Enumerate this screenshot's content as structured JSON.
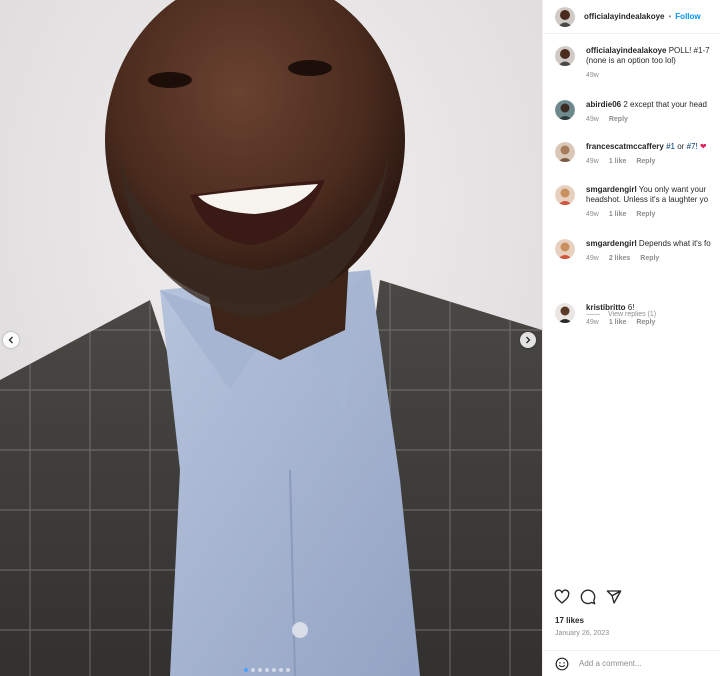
{
  "post": {
    "username": "officialayindealakoye",
    "separator": "•",
    "follow_label": "Follow",
    "caption_text": "POLL! #1-7",
    "caption_line2": "(none is an option too lol)",
    "caption_time": "49w"
  },
  "comments": [
    {
      "username": "abirdie06",
      "text": "2 except that your head",
      "time": "49w",
      "likes": "",
      "reply": "Reply"
    },
    {
      "username": "francescatmccaffery",
      "tag1": "#1",
      "or": "or",
      "tag2": "#7!",
      "emoji": "❤",
      "time": "49w",
      "likes": "1 like",
      "reply": "Reply"
    },
    {
      "username": "smgardengirl",
      "text": "You only want your",
      "text_line2": "headshot. Unless it's a laughter yo",
      "time": "49w",
      "likes": "1 like",
      "reply": "Reply"
    },
    {
      "username": "smgardengirl",
      "text": "Depends what it's fo",
      "time": "49w",
      "likes": "2 likes",
      "reply": "Reply"
    },
    {
      "username": "kristibritto",
      "text": "6!",
      "time": "49w",
      "likes": "1 like",
      "reply": "Reply"
    }
  ],
  "view_replies": "View replies (1)",
  "likes_count": "17 likes",
  "date": "January 26, 2023",
  "comment_input": {
    "placeholder": "Add a comment..."
  },
  "icons": {
    "like": "heart-icon",
    "comment": "comment-icon",
    "share": "share-icon",
    "emoji": "emoji-icon"
  },
  "colors": {
    "link": "#0095f6",
    "tag": "#00376b",
    "muted": "#8e8e8e"
  }
}
